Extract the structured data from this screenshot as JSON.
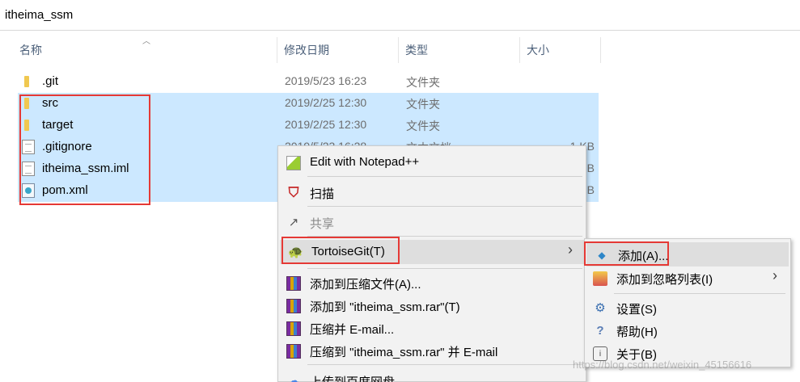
{
  "address": {
    "path": "itheima_ssm"
  },
  "columns": {
    "name": "名称",
    "date": "修改日期",
    "type": "类型",
    "size": "大小"
  },
  "files": [
    {
      "name": ".git",
      "date": "2019/5/23 16:23",
      "type": "文件夹",
      "size": "",
      "icon": "folder-icon",
      "selected": false
    },
    {
      "name": "src",
      "date": "2019/2/25 12:30",
      "type": "文件夹",
      "size": "",
      "icon": "folder-icon",
      "selected": true
    },
    {
      "name": "target",
      "date": "2019/2/25 12:30",
      "type": "文件夹",
      "size": "",
      "icon": "folder-icon",
      "selected": true
    },
    {
      "name": ".gitignore",
      "date": "2019/5/23 16:28",
      "type": "文本文档",
      "size": "1 KB",
      "icon": "text-file-icon",
      "selected": true
    },
    {
      "name": "itheima_ssm.iml",
      "date": "",
      "type": "",
      "size": "B",
      "icon": "file-icon",
      "selected": true
    },
    {
      "name": "pom.xml",
      "date": "",
      "type": "",
      "size": "B",
      "icon": "xml-file-icon",
      "selected": true
    }
  ],
  "context_menu": {
    "items": [
      {
        "label": "Edit with Notepad++",
        "icon": "notepad-icon"
      },
      {
        "label": "扫描",
        "icon": "mcafee-shield-icon"
      },
      {
        "label": "共享",
        "icon": "share-icon"
      },
      {
        "label": "TortoiseGit(T)",
        "icon": "tortoisegit-icon"
      },
      {
        "label": "添加到压缩文件(A)...",
        "icon": "winrar-icon"
      },
      {
        "label": "添加到 \"itheima_ssm.rar\"(T)",
        "icon": "winrar-icon"
      },
      {
        "label": "压缩并 E-mail...",
        "icon": "winrar-icon"
      },
      {
        "label": "压缩到 \"itheima_ssm.rar\" 并 E-mail",
        "icon": "winrar-icon"
      },
      {
        "label": "上传到百度网盘",
        "icon": "baidu-cloud-icon"
      }
    ]
  },
  "submenu": {
    "items": [
      {
        "label": "添加(A)...",
        "icon": "add-icon"
      },
      {
        "label": "添加到忽略列表(I)",
        "icon": "ignore-list-icon"
      },
      {
        "label": "设置(S)",
        "icon": "settings-icon"
      },
      {
        "label": "帮助(H)",
        "icon": "help-icon"
      },
      {
        "label": "关于(B)",
        "icon": "about-icon"
      }
    ]
  },
  "watermark": "https://blog.csdn.net/weixin_45156616",
  "colors": {
    "selection": "#cce8ff",
    "highlight_box": "#e53935",
    "menu_bg": "#f2f2f2"
  }
}
